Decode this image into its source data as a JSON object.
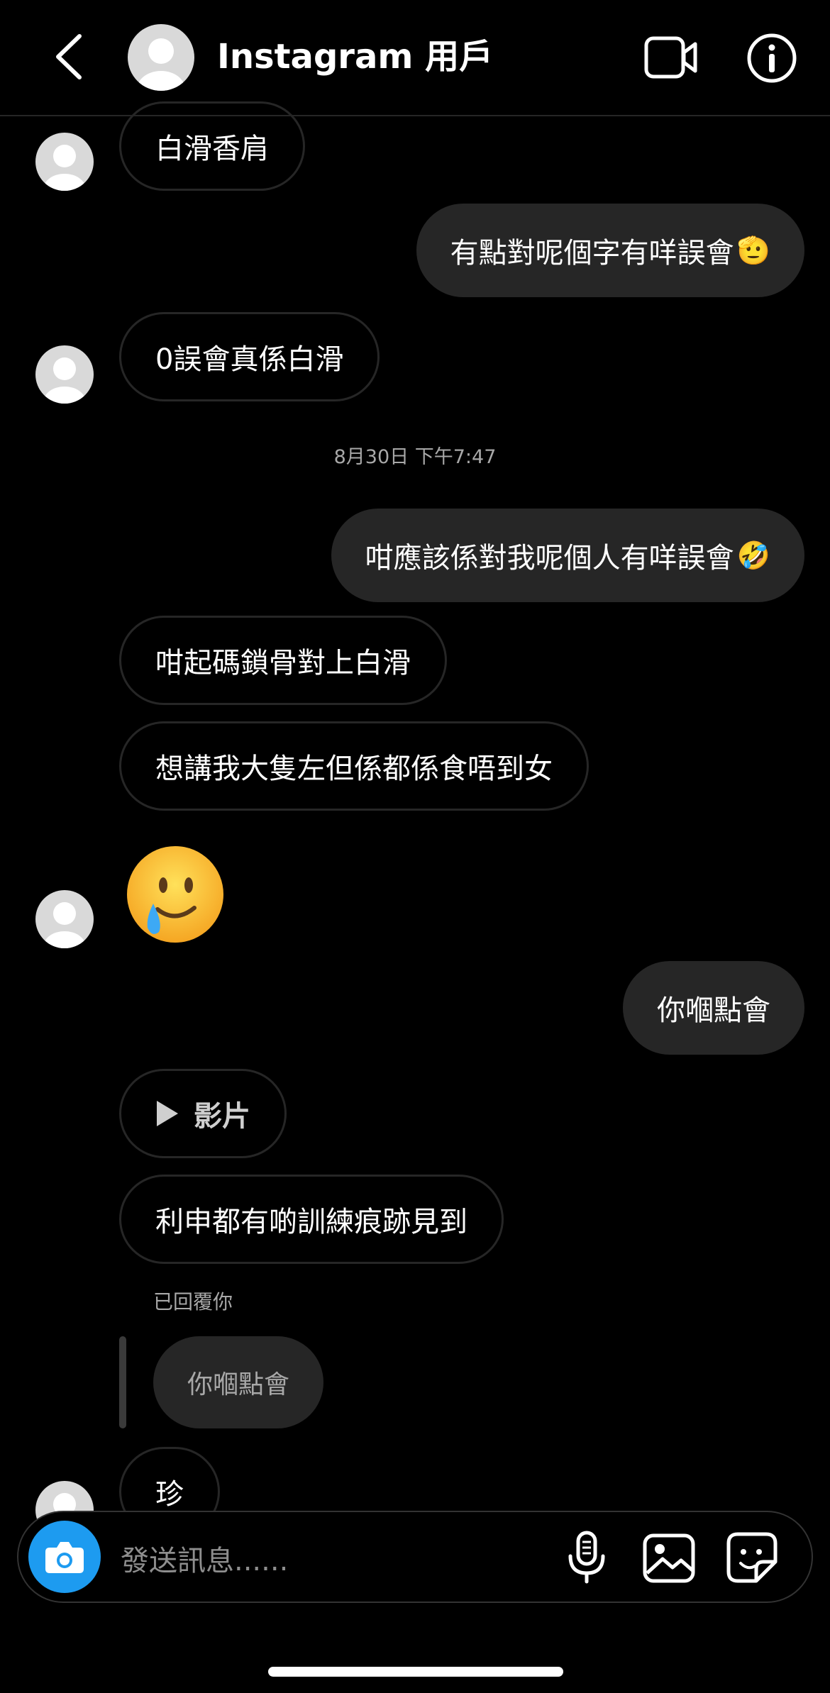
{
  "header": {
    "title": "Instagram 用戶",
    "icons": [
      "chevron-left-icon",
      "avatar",
      "video-call-icon",
      "info-icon"
    ]
  },
  "messages": [
    {
      "side": "in",
      "text": "白滑香肩"
    },
    {
      "side": "out",
      "text": "有點對呢個字有咩誤會",
      "emoji": "🫡"
    },
    {
      "side": "in",
      "text": "0誤會真係白滑"
    },
    {
      "side": "out",
      "text": "咁應該係對我呢個人有咩誤會",
      "emoji": "🤣"
    },
    {
      "side": "in",
      "text": "咁起碼鎖骨對上白滑"
    },
    {
      "side": "in",
      "text": "想講我大隻左但係都係食唔到女"
    },
    {
      "side": "out",
      "text": "你嗰點會"
    },
    {
      "side": "in",
      "text": "影片"
    },
    {
      "side": "in",
      "text": "利申都有啲訓練痕跡見到"
    },
    {
      "side": "in",
      "text": "珍"
    }
  ],
  "timestamp": "8月30日 下午7:47",
  "reply": {
    "label": "已回覆你",
    "quoted_text": "你嗰點會"
  },
  "composer": {
    "placeholder": "發送訊息......",
    "icons": [
      "camera-icon",
      "microphone-icon",
      "gallery-icon",
      "sticker-icon"
    ]
  },
  "colors": {
    "background": "#000000",
    "bubble_out": "#262626",
    "bubble_in_border": "#262626",
    "camera_button": "#1d9bf0",
    "muted_text": "#a8a8a8"
  }
}
